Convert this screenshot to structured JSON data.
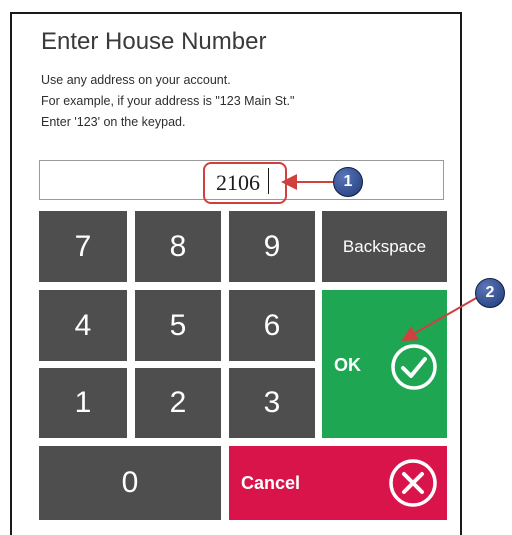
{
  "dialog": {
    "title": "Enter House Number",
    "instructions": [
      "Use any address on your account.",
      "For example, if your address is \"123 Main St.\"",
      "Enter '123' on the keypad."
    ]
  },
  "entry": {
    "value": "2106"
  },
  "keypad": {
    "keys": {
      "k7": "7",
      "k8": "8",
      "k9": "9",
      "k4": "4",
      "k5": "5",
      "k6": "6",
      "k1": "1",
      "k2": "2",
      "k3": "3",
      "k0": "0"
    },
    "backspace_label": "Backspace",
    "ok_label": "OK",
    "cancel_label": "Cancel"
  },
  "annotations": {
    "callout_1": "1",
    "callout_2": "2"
  },
  "colors": {
    "key": "#4e4e4e",
    "ok": "#1fa653",
    "cancel": "#d9144a",
    "highlight": "#d0403f",
    "callout": "#2a4a8f"
  }
}
